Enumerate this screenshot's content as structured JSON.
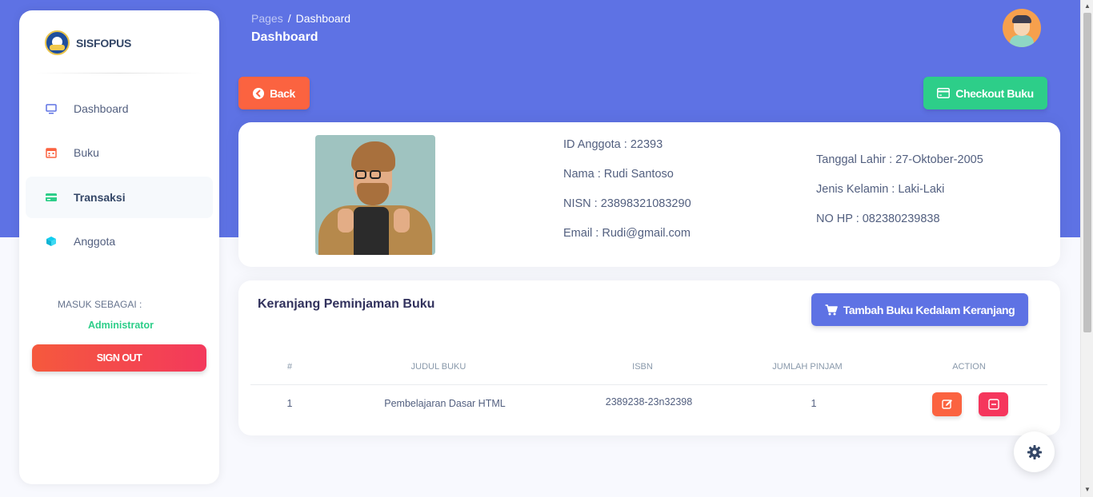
{
  "sidebar": {
    "brand": "SISFOPUS",
    "items": [
      {
        "label": "Dashboard",
        "icon": "monitor-icon",
        "active": false
      },
      {
        "label": "Buku",
        "icon": "calendar-icon",
        "active": false
      },
      {
        "label": "Transaksi",
        "icon": "credit-card-icon",
        "active": true
      },
      {
        "label": "Anggota",
        "icon": "cube-icon",
        "active": false
      }
    ],
    "login_as_label": "MASUK SEBAGAI :",
    "role": "Administrator",
    "sign_out_label": "SIGN OUT"
  },
  "header": {
    "breadcrumb_parent": "Pages",
    "breadcrumb_separator": "/",
    "breadcrumb_current": "Dashboard",
    "title": "Dashboard"
  },
  "actions": {
    "back_label": "Back",
    "checkout_label": "Checkout Buku"
  },
  "member": {
    "id": "ID Anggota : 22393",
    "name": "Nama : Rudi Santoso",
    "nisn": "NISN : 23898321083290",
    "email": "Email : Rudi@gmail.com",
    "birth_date": "Tanggal Lahir : 27-Oktober-2005",
    "gender": "Jenis Kelamin : Laki-Laki",
    "phone": "NO HP : 082380239838"
  },
  "cart": {
    "title": "Keranjang Peminjaman Buku",
    "add_label": "Tambah Buku Kedalam Keranjang",
    "columns": [
      "#",
      "JUDUL BUKU",
      "ISBN",
      "JUMLAH PINJAM",
      "ACTION"
    ],
    "rows": [
      {
        "no": "1",
        "title": "Pembelajaran Dasar HTML",
        "isbn": "2389238-23n32398",
        "qty": "1"
      }
    ]
  },
  "colors": {
    "primary": "#5e72e4",
    "success": "#2dce89",
    "warning": "#fb6340",
    "danger": "#f5365c"
  }
}
